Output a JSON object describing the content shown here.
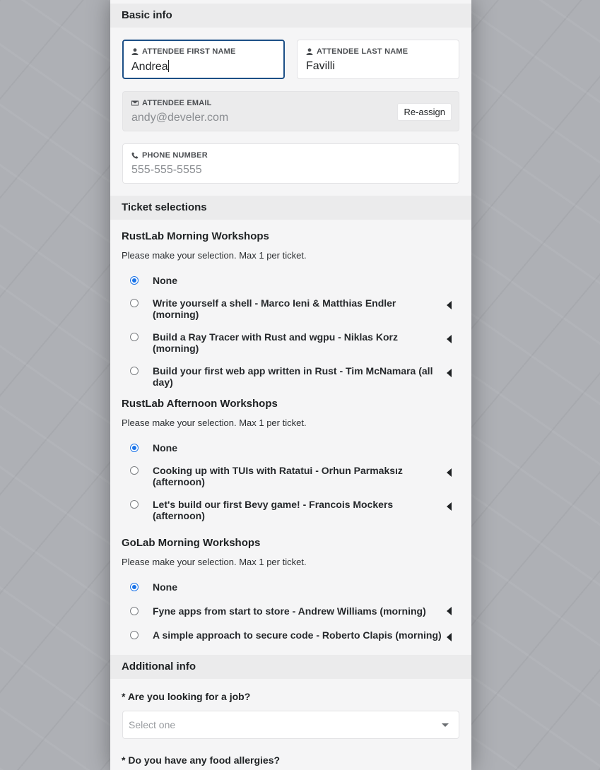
{
  "basic_info": {
    "title": "Basic info",
    "first_name": {
      "label": "ATTENDEE FIRST NAME",
      "value": "Andrea"
    },
    "last_name": {
      "label": "ATTENDEE LAST NAME",
      "value": "Favilli"
    },
    "email": {
      "label": "ATTENDEE EMAIL",
      "value": "andy@develer.com",
      "button": "Re-assign"
    },
    "phone": {
      "label": "PHONE NUMBER",
      "placeholder": "555-555-5555"
    }
  },
  "tickets": {
    "title": "Ticket selections",
    "groups": [
      {
        "title": "RustLab Morning Workshops",
        "hint": "Please make your selection. Max 1 per ticket.",
        "options": [
          {
            "label": "None",
            "checked": true
          },
          {
            "label": "Write yourself a shell - Marco Ieni & Matthias Endler (morning)",
            "checked": false
          },
          {
            "label": "Build a Ray Tracer with Rust and wgpu - Niklas Korz (morning)",
            "checked": false
          },
          {
            "label": "Build your first web app written in Rust - Tim McNamara (all day)",
            "checked": false
          }
        ]
      },
      {
        "title": "RustLab Afternoon Workshops",
        "hint": "Please make your selection. Max 1 per ticket.",
        "options": [
          {
            "label": "None",
            "checked": true
          },
          {
            "label": "Cooking up with TUIs with Ratatui - Orhun Parmaksız (afternoon)",
            "checked": false
          },
          {
            "label": "Let's build our first Bevy game! - Francois Mockers (afternoon)",
            "checked": false
          }
        ]
      },
      {
        "title": "GoLab Morning Workshops",
        "hint": "Please make your selection. Max 1 per ticket.",
        "options": [
          {
            "label": "None",
            "checked": true
          },
          {
            "label": "Fyne apps from start to store - Andrew Williams (morning)",
            "checked": false
          },
          {
            "label": "A simple approach to secure code - Roberto Clapis (morning)",
            "checked": false
          }
        ]
      }
    ]
  },
  "additional": {
    "title": "Additional info",
    "job_question": "* Are you looking for a job?",
    "job_select_placeholder": "Select one",
    "allergies_question": "* Do you have any food allergies?"
  },
  "colors": {
    "accent": "#1a73e8",
    "focus_border": "#1c4f86",
    "panel_bg": "#f5f5f6",
    "section_bg": "#ebebec"
  }
}
